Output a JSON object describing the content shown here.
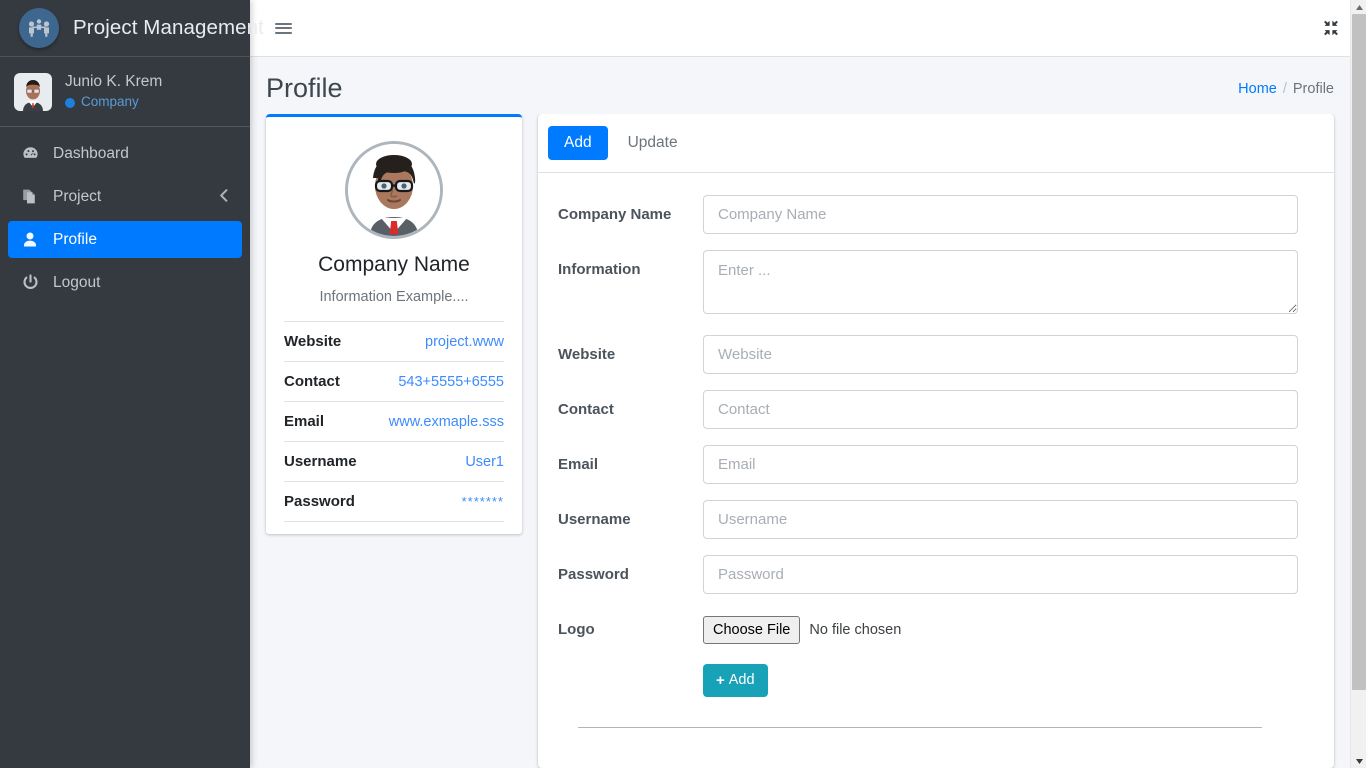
{
  "sidebar": {
    "brand": {
      "title": "Project Management",
      "logo_icon": "network-people-logo-icon"
    },
    "user": {
      "name": "Junio K. Krem",
      "role": "Company",
      "avatar_icon": "user-avatar"
    },
    "items": [
      {
        "label": "Dashboard",
        "icon": "tachometer-icon",
        "active": false,
        "arrow": ""
      },
      {
        "label": "Project",
        "icon": "copy-files-icon",
        "active": false,
        "arrow": "chevron-left-icon"
      },
      {
        "label": "Profile",
        "icon": "user-icon",
        "active": true,
        "arrow": ""
      },
      {
        "label": "Logout",
        "icon": "power-off-icon",
        "active": false,
        "arrow": ""
      }
    ]
  },
  "navbar": {
    "menu_icon": "hamburger-menu-icon",
    "fullscreen_icon": "compress-arrows-icon"
  },
  "header": {
    "title": "Profile",
    "breadcrumb": {
      "home": "Home",
      "separator": "/",
      "current": "Profile"
    }
  },
  "profile_card": {
    "photo_icon": "user-photo",
    "name": "Company Name",
    "subtitle": "Information Example....",
    "info": [
      {
        "key": "Website",
        "value": "project.www"
      },
      {
        "key": "Contact",
        "value": "543+5555+6555"
      },
      {
        "key": "Email",
        "value": "www.exmaple.sss"
      },
      {
        "key": "Username",
        "value": "User1"
      },
      {
        "key": "Password",
        "value": "*******"
      }
    ]
  },
  "form_card": {
    "tabs": [
      {
        "label": "Add",
        "active": true
      },
      {
        "label": "Update",
        "active": false
      }
    ],
    "fields": [
      {
        "label": "Company Name",
        "placeholder": "Company Name",
        "type": "text"
      },
      {
        "label": "Information",
        "placeholder": "Enter ...",
        "type": "textarea"
      },
      {
        "label": "Website",
        "placeholder": "Website",
        "type": "text"
      },
      {
        "label": "Contact",
        "placeholder": "Contact",
        "type": "text"
      },
      {
        "label": "Email",
        "placeholder": "Email",
        "type": "text"
      },
      {
        "label": "Username",
        "placeholder": "Username",
        "type": "text"
      },
      {
        "label": "Password",
        "placeholder": "Password",
        "type": "text"
      }
    ],
    "logo_field": {
      "label": "Logo",
      "button_label": "Choose File",
      "file_status": "No file chosen"
    },
    "submit": {
      "label": "Add",
      "icon": "plus-icon"
    }
  },
  "colors": {
    "sidebar_bg": "#343a40",
    "accent_blue": "#007bff",
    "link_blue": "#3d8bfd",
    "teal": "#17a2b8",
    "page_bg": "#f4f6f9"
  }
}
